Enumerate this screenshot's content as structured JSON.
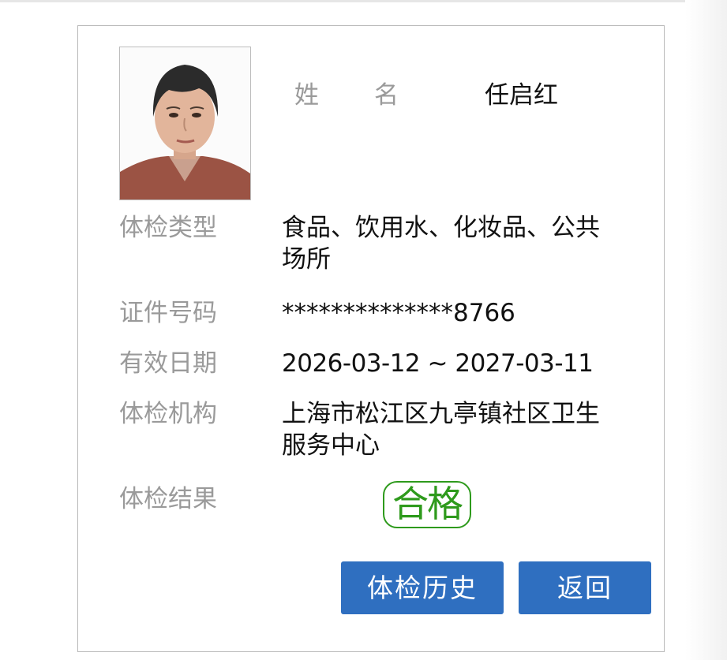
{
  "profile": {
    "name_label_chars": [
      "姓",
      "名"
    ],
    "name": "任启红"
  },
  "fields": [
    {
      "label": "体检类型",
      "value": "食品、饮用水、化妆品、公共场所"
    },
    {
      "label": "证件号码",
      "value": "**************8766"
    },
    {
      "label": "有效日期",
      "value": "2026-03-12 ~ 2027-03-11"
    },
    {
      "label": "体检机构",
      "value": "上海市松江区九亭镇社区卫生服务中心"
    },
    {
      "label": "体检结果",
      "value": "合格"
    }
  ],
  "buttons": {
    "history": "体检历史",
    "back": "返回"
  },
  "colors": {
    "accent": "#2f6fc0",
    "pass_green": "#2e9a1c",
    "label_gray": "#9a9a9a"
  }
}
